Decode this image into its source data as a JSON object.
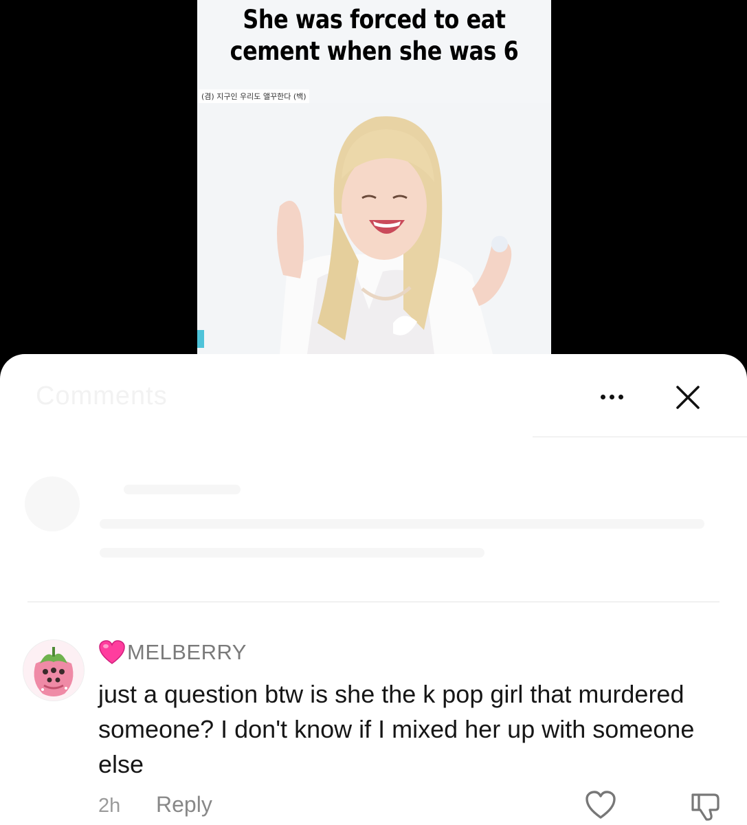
{
  "video": {
    "caption_line1": "She was forced to eat",
    "caption_line2": "cement when she was 6",
    "subtitle_overlay": "(겸) 지구인 우리도 앨꾸한다 (백)"
  },
  "sheet": {
    "header_ghost_text": "Comments"
  },
  "comment": {
    "username": "MELBERRY",
    "text": "just a question btw is she the k pop girl that murdered someone? I don't know if I mixed her up with someone else",
    "time": "2h",
    "reply_label": "Reply"
  },
  "colors": {
    "heart_emoji": "#ff3d9e",
    "username": "#7a7a7a",
    "body_text": "#161616",
    "meta_text": "#9a9a9a"
  },
  "icons": [
    "more-dots-icon",
    "close-icon",
    "heart-emoji-icon",
    "like-heart-icon",
    "dislike-icon",
    "strawberry-avatar"
  ]
}
